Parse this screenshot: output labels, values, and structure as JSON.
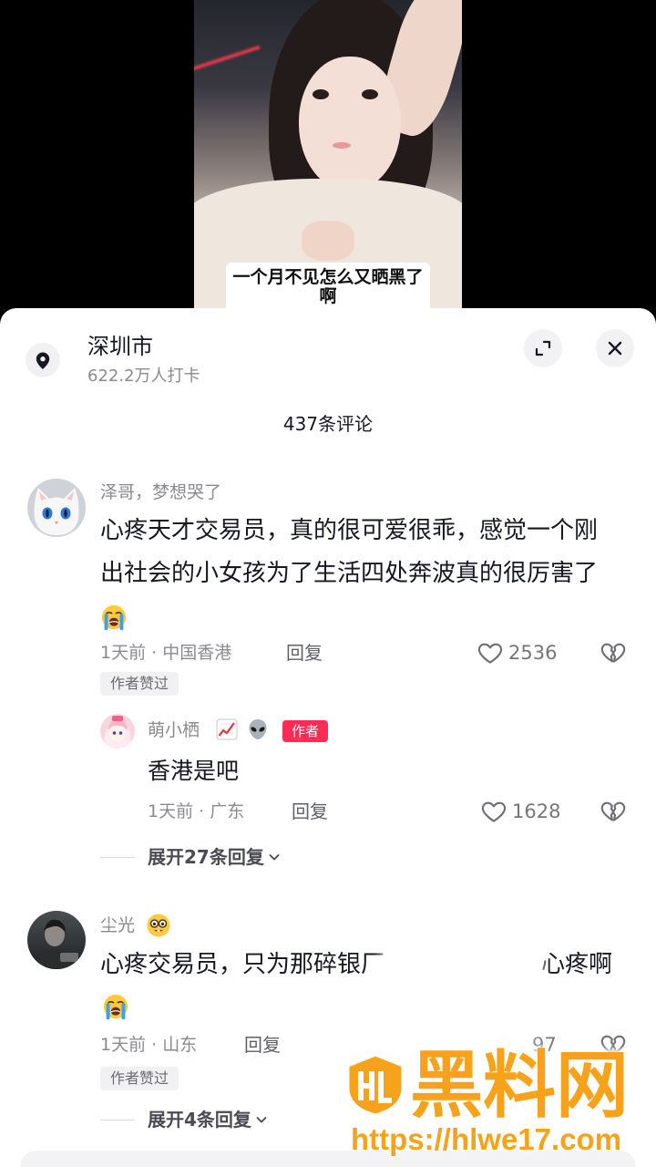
{
  "video": {
    "caption": "一个月不见怎么又晒黑了啊"
  },
  "location": {
    "icon": "location-pin-icon",
    "name": "深圳市",
    "checkins": "622.2万人打卡"
  },
  "header": {
    "expand_icon": "expand-icon",
    "close_icon": "close-icon"
  },
  "comments_title": "437条评论",
  "comments": [
    {
      "avatar": "white-cat-avatar",
      "author": "泽哥，梦想哭了",
      "text": "心疼天才交易员，真的很可爱很乖，感觉一个刚出社会的小女孩为了生活四处奔波真的很厉害了",
      "text_emoji": "loudly-crying-face-emoji",
      "meta": "1天前 · 中国香港",
      "reply_label": "回复",
      "like_icon": "heart-outline-icon",
      "likes": "2536",
      "dislike_icon": "broken-heart-icon",
      "badge": "作者赞过",
      "replies": [
        {
          "avatar": "anime-girl-avatar",
          "author": "萌小栖",
          "author_emojis": [
            "chart-increasing-emoji",
            "alien-emoji"
          ],
          "author_tag": "作者",
          "text": "香港是吧",
          "meta": "1天前 · 广东",
          "reply_label": "回复",
          "like_icon": "heart-outline-icon",
          "likes": "1628",
          "dislike_icon": "broken-heart-icon"
        }
      ],
      "expand_label": "展开27条回复"
    },
    {
      "avatar": "dark-photo-avatar",
      "author": "尘光",
      "author_emojis": [
        "nerd-face-emoji"
      ],
      "text_visible_start": "心疼交易员，只为那碎银厂",
      "text_visible_end": "心疼啊",
      "text_emoji": "loudly-crying-face-emoji",
      "meta": "1天前 · 山东",
      "reply_label": "回复",
      "likes_visible": "97",
      "dislike_icon": "broken-heart-icon",
      "badge": "作者赞过",
      "expand_label": "展开4条回复"
    }
  ],
  "watermark": {
    "brand": "黑料网",
    "url": "https://hlwe17.com"
  },
  "colors": {
    "author_tag": "#fe2c55",
    "primary_text": "#161823",
    "secondary_text": "#8a8b91",
    "watermark": "#f7a21b"
  }
}
